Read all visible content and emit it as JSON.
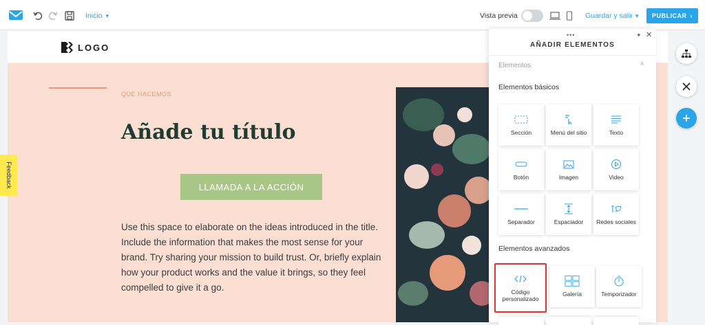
{
  "topbar": {
    "page_select": "Inicio",
    "preview_label": "Vista previa",
    "save_label": "Guardar y salir",
    "publish_label": "PUBLICAR"
  },
  "site": {
    "logo_text": "LOGO",
    "kicker": "QUE HACEMOS",
    "headline": "Añade tu título",
    "cta": "LLAMADA A LA ACCIÓN",
    "body": "Use this space to elaborate on the ideas introduced in the title. Include the information that makes the most sense for your brand. Try sharing your mission to build trust. Or, briefly explain how your product works and the value it brings, so they feel compelled to give it a go."
  },
  "feedback_label": "Feedback",
  "panel": {
    "title": "AÑADIR ELEMENTOS",
    "section": "Elementos",
    "basic_title": "Elementos básicos",
    "basic": [
      {
        "label": "Sección",
        "icon": "section-icon"
      },
      {
        "label": "Menú del sitio",
        "icon": "menu-icon"
      },
      {
        "label": "Texto",
        "icon": "text-icon"
      },
      {
        "label": "Botón",
        "icon": "button-icon"
      },
      {
        "label": "Imagen",
        "icon": "image-icon"
      },
      {
        "label": "Video",
        "icon": "video-icon"
      },
      {
        "label": "Separador",
        "icon": "divider-icon"
      },
      {
        "label": "Espaciador",
        "icon": "spacer-icon"
      },
      {
        "label": "Redes sociales",
        "icon": "social-icon"
      }
    ],
    "advanced_title": "Elementos avanzados",
    "advanced": [
      {
        "label": "Código personalizado",
        "icon": "code-icon"
      },
      {
        "label": "Galería",
        "icon": "gallery-icon"
      },
      {
        "label": "Temporizador",
        "icon": "timer-icon"
      }
    ]
  },
  "colors": {
    "accent": "#2aa5e8",
    "canvas_bg": "#fbdfd3",
    "cta_bg": "#a8c686",
    "headline": "#1f3b32",
    "selection": "#d8363b"
  }
}
